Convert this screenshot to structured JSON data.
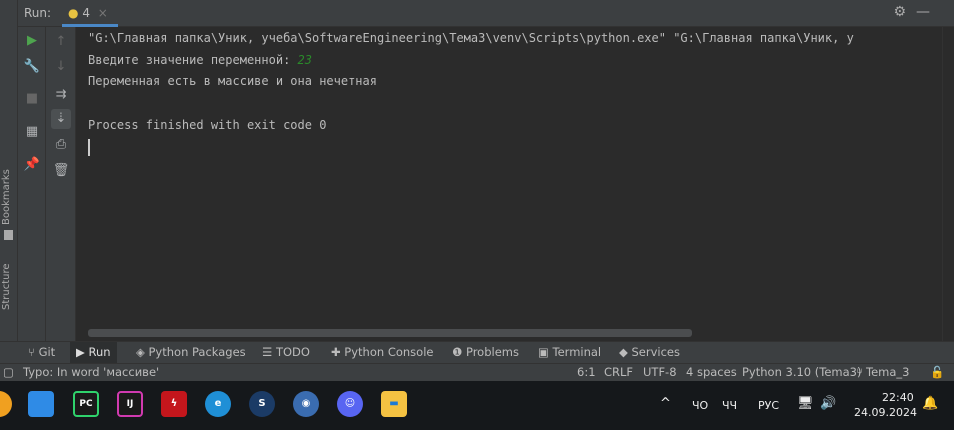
{
  "header": {
    "run_label": "Run:",
    "tab_label": "4",
    "close": "×",
    "gear": "⚙",
    "minimize": "—"
  },
  "sidebar": {
    "bookmarks": "Bookmarks",
    "structure": "Structure"
  },
  "console": {
    "command": "\"G:\\Главная папка\\Уник, учеба\\SoftwareEngineering\\Тема3\\venv\\Scripts\\python.exe\" \"G:\\Главная папка\\Уник, у",
    "prompt": "Введите значение переменной: ",
    "input": "23",
    "output": "Переменная есть в массиве и она нечетная",
    "exit": "Process finished with exit code 0"
  },
  "tool_tabs": [
    {
      "label": "Git",
      "icon": "git-branch"
    },
    {
      "label": "Run",
      "icon": "play"
    },
    {
      "label": "Python Packages",
      "icon": "layers"
    },
    {
      "label": "TODO",
      "icon": "list"
    },
    {
      "label": "Python Console",
      "icon": "python"
    },
    {
      "label": "Problems",
      "icon": "warning"
    },
    {
      "label": "Terminal",
      "icon": "terminal"
    },
    {
      "label": "Services",
      "icon": "services"
    }
  ],
  "status": {
    "message": "Typo: In word 'массиве'",
    "position": "6:1",
    "line_sep": "CRLF",
    "encoding": "UTF-8",
    "indent": "4 spaces",
    "interpreter": "Python 3.10 (Tema3)",
    "branch": "Tema_3"
  },
  "taskbar": {
    "apps": [
      {
        "name": "VS Code",
        "label": "⟩⟨",
        "color": "#2f8be6"
      },
      {
        "name": "PyCharm",
        "label": "PC",
        "color": "#1a1a1a"
      },
      {
        "name": "IntelliJ",
        "label": "IJ",
        "color": "#1a1a1a"
      },
      {
        "name": "Acrobat",
        "label": "ϟ",
        "color": "#c4161c"
      },
      {
        "name": "Edge",
        "label": "e",
        "color": "#1f8fd6"
      },
      {
        "name": "Steam",
        "label": "S",
        "color": "#1b3b66"
      },
      {
        "name": "App",
        "label": "◉",
        "color": "#3a6cb0"
      },
      {
        "name": "Discord",
        "label": "☺",
        "color": "#5865f2"
      },
      {
        "name": "Explorer",
        "label": "▬",
        "color": "#f5c242"
      }
    ],
    "tray": {
      "lang1": "ЧО",
      "lang2": "ЧЧ",
      "input_lang": "РУС",
      "time": "22:40",
      "date": "24.09.2024"
    }
  }
}
